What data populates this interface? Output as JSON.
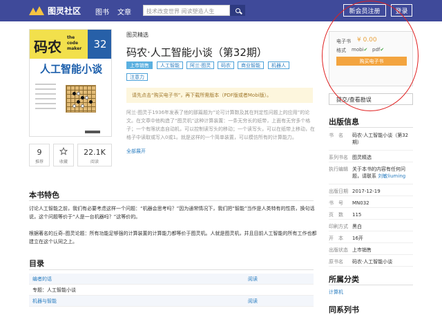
{
  "header": {
    "logo_text": "图灵社区",
    "nav": [
      "图书",
      "文章"
    ],
    "search_placeholder": "技术改变世界 阅读塑造人生",
    "register_label": "新会员注册",
    "login_label": "登录"
  },
  "cover": {
    "big_text": "码农",
    "sub_lines": [
      "the",
      "code",
      "maker"
    ],
    "issue": "32",
    "title": "人工智能小谈"
  },
  "stats": [
    {
      "value": "9",
      "label": "推荐"
    },
    {
      "value": "",
      "label": "收藏"
    },
    {
      "value": "22.1K",
      "label": "阅读"
    }
  ],
  "book": {
    "breadcrumb": "图灵精选",
    "title": "码农·人工智能小谈（第32期）",
    "tags": [
      "上市销售",
      "人工智能",
      "阿兰·图灵",
      "码农",
      "商业智能",
      "机器人",
      "注意力"
    ],
    "notice": "请先点击“购买电子书”，再下载所需版本（PDF版或者Mobi版）。",
    "description": "阿兰·图灵于1936年发表了他的那篇题为“论可计算数及其在判定性问题上的应用”的论文。在文章中他构造了“图灵机”这种计算装置：一条无穷长的纸带，上面有无穷多个格子；一个有限状态自动机，可以控制读写头的移动；一个读写头，可以在纸带上移动，在格子中读取或写入0或1。就是这样的一个简单装置，可以模仿所有的计算能力。",
    "read_more": "全部展开"
  },
  "purchase": {
    "ebook_label": "电子书",
    "price": "¥ 0.00",
    "format_label": "格式",
    "formats": [
      "mobi",
      "pdf"
    ],
    "buy_label": "购买电子书",
    "errata_label": "提交/查看勘误"
  },
  "publication": {
    "title": "出版信息",
    "rows": [
      {
        "k": "书　名",
        "v": "码农·人工智能小谈（第32期）"
      },
      {
        "k": "系列书名",
        "v": "图灵精选"
      },
      {
        "k": "执行编辑",
        "v": "关于本书的内容有任何问题，请联系 ",
        "link": "刘敏liuming"
      },
      {
        "k": "出版日期",
        "v": "2017-12-19"
      },
      {
        "k": "书　号",
        "v": "MN032"
      },
      {
        "k": "页　数",
        "v": "115"
      },
      {
        "k": "印刷方式",
        "v": "黑白"
      },
      {
        "k": "开　本",
        "v": "16开"
      },
      {
        "k": "出版状态",
        "v": "上市销售"
      },
      {
        "k": "原书名",
        "v": "码农·人工智能小谈"
      }
    ]
  },
  "category": {
    "title": "所属分类",
    "link": "计算机"
  },
  "series_title": "同系列书",
  "features": {
    "title": "本书特色",
    "para1": "讨论人工智能之前，我们有必要考虑这样一个问题：“机器会思考吗？”因为通常情况下，我们把“智能”当作是人类特有的性质，换句话说，这个问题等价于“人是一台机器吗？”这等价的。",
    "para2": "根据著名的丘奇–图灵论题：所有功能足够强的计算装置的计算能力都等价于图灵机。人就是图灵机，并且目前人工智能的所有工作也都建立在这个认同之上。"
  },
  "toc": {
    "title": "目录",
    "rows": [
      {
        "title": "编者的话",
        "action": "阅读",
        "link": true
      },
      {
        "title": "专题：人工智能小谈",
        "action": "",
        "link": false
      },
      {
        "title": "机器与智能",
        "action": "阅读",
        "link": true
      }
    ]
  }
}
